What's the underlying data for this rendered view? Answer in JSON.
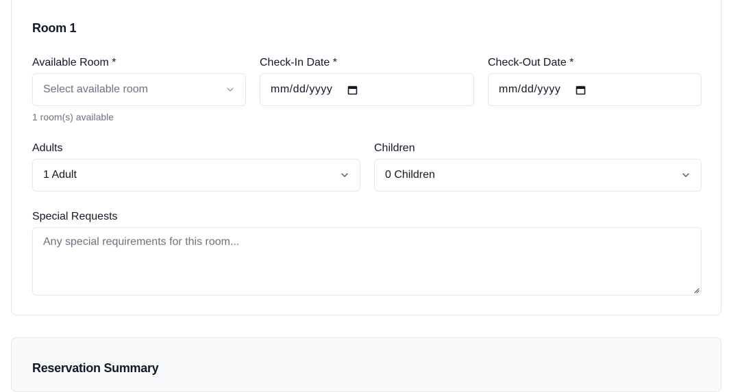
{
  "room": {
    "title": "Room 1",
    "available_room": {
      "label": "Available Room *",
      "placeholder": "Select available room",
      "hint": "1 room(s) available"
    },
    "check_in": {
      "label": "Check-In Date *",
      "value": "mm/dd/yyyy"
    },
    "check_out": {
      "label": "Check-Out Date *",
      "value": "mm/dd/yyyy"
    },
    "adults": {
      "label": "Adults",
      "value": "1 Adult"
    },
    "children": {
      "label": "Children",
      "value": "0 Children"
    },
    "special_requests": {
      "label": "Special Requests",
      "placeholder": "Any special requirements for this room..."
    }
  },
  "summary": {
    "title": "Reservation Summary"
  },
  "icons": {
    "select": "chevron-down-icon",
    "date": "calendar-icon",
    "resize": "resize-handle-icon"
  },
  "colors": {
    "border": "#e5e7eb",
    "text": "#111827",
    "muted": "#6b7280",
    "summary_bg": "#f9fafb"
  }
}
